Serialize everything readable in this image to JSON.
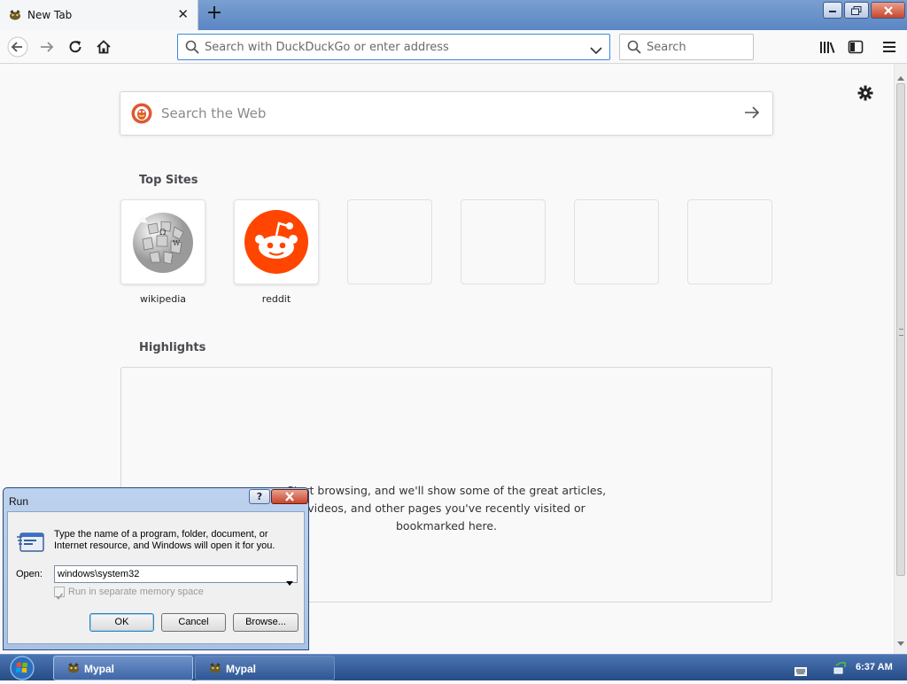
{
  "browser": {
    "tab": {
      "title": "New Tab",
      "favicon": "mypal-icon"
    },
    "new_tab_icon": "plus-icon",
    "window_controls": [
      "minimize-icon",
      "restore-icon",
      "close-icon"
    ],
    "nav": {
      "back_icon": "arrow-left-icon",
      "forward_icon": "arrow-right-icon",
      "reload_icon": "reload-icon",
      "home_icon": "home-icon"
    },
    "urlbar": {
      "placeholder": "Search with DuckDuckGo or enter address",
      "value": ""
    },
    "searchbar": {
      "placeholder": "Search"
    },
    "toolbar_icons": [
      "library-icon",
      "sidebar-icon",
      "menu-icon"
    ]
  },
  "newtab": {
    "web_search": {
      "placeholder": "Search the Web"
    },
    "top_sites": {
      "title": "Top Sites",
      "tiles": [
        {
          "label": "wikipedia",
          "icon": "wikipedia-globe-icon"
        },
        {
          "label": "reddit",
          "icon": "reddit-alien-icon"
        },
        {
          "label": ""
        },
        {
          "label": ""
        },
        {
          "label": ""
        },
        {
          "label": ""
        }
      ]
    },
    "highlights": {
      "title": "Highlights",
      "lines": [
        "Start browsing, and we'll show some of the great articles,",
        "videos, and other pages you've recently visited or",
        "bookmarked here."
      ]
    }
  },
  "run_dialog": {
    "title": "Run",
    "help_label": "?",
    "description": "Type the name of a program, folder, document, or Internet resource, and Windows will open it for you.",
    "open_label": "Open:",
    "open_value": "windows\\system32",
    "checkbox_label": "Run in separate memory space",
    "checkbox_checked": true,
    "ok_label": "OK",
    "cancel_label": "Cancel",
    "browse_label": "Browse..."
  },
  "taskbar": {
    "items": [
      {
        "label": "Mypal",
        "active": true
      },
      {
        "label": "Mypal",
        "active": false
      }
    ],
    "clock": "6:37 AM"
  },
  "colors": {
    "accent": "#3a87e0",
    "reddit": "#ff4500",
    "taskbar": "#274c86"
  }
}
